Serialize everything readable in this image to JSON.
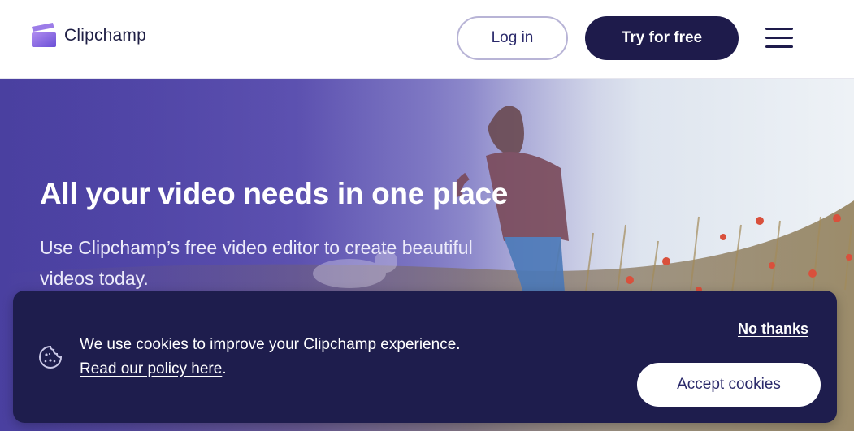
{
  "header": {
    "brand": "Clipchamp",
    "login_label": "Log in",
    "try_label": "Try for free"
  },
  "hero": {
    "title": "All your video needs in one place",
    "subtitle": "Use Clipchamp’s free video editor to create beautiful videos today."
  },
  "cookie_banner": {
    "message": "We use cookies to improve your Clipchamp experience.",
    "policy_link": "Read our policy here",
    "policy_suffix": ".",
    "no_thanks_label": "No thanks",
    "accept_label": "Accept cookies"
  },
  "icons": {
    "logo": "clipchamp-logo-icon",
    "menu": "hamburger-menu-icon",
    "cookie": "cookie-icon"
  },
  "colors": {
    "brand_dark": "#1e1b4b",
    "banner_bg": "#1e1d4d",
    "hero_purple": "#4a40a0",
    "login_border": "#b8b4d6"
  }
}
